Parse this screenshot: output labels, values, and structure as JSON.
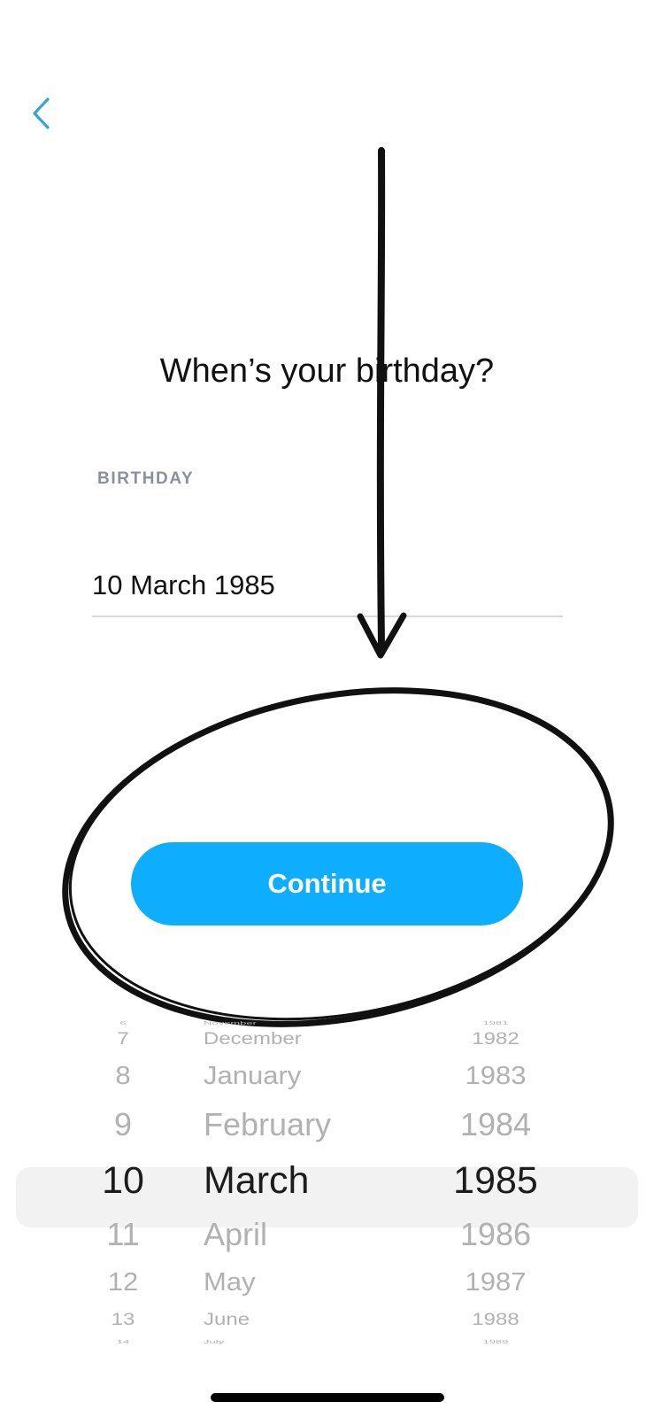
{
  "header": {
    "back_icon": "chevron-left-icon"
  },
  "title": "When’s your birthday?",
  "birthday_field": {
    "label": "BIRTHDAY",
    "value": "10 March 1985"
  },
  "continue_button": {
    "label": "Continue"
  },
  "picker": {
    "days": [
      "6",
      "7",
      "8",
      "9",
      "10",
      "11",
      "12",
      "13",
      "14"
    ],
    "months": [
      "November",
      "December",
      "January",
      "February",
      "March",
      "April",
      "May",
      "June",
      "July"
    ],
    "years": [
      "1981",
      "1982",
      "1983",
      "1984",
      "1985",
      "1986",
      "1987",
      "1988",
      "1989"
    ],
    "selected_index": 4
  },
  "colors": {
    "accent": "#0fadfe",
    "back_chevron": "#3aa3d3",
    "label_gray": "#8a919a",
    "picker_gray": "#b1b1b1"
  }
}
